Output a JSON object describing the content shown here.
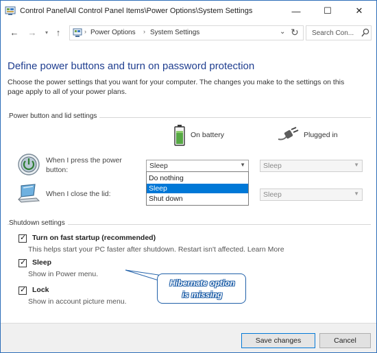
{
  "window": {
    "title": "Control Panel\\All Control Panel Items\\Power Options\\System Settings",
    "minimize": "—",
    "maximize": "☐",
    "close": "✕"
  },
  "nav": {
    "back": "←",
    "forward": "→",
    "history": "▾",
    "up": "↑",
    "breadcrumbs": [
      "Power Options",
      "System Settings"
    ],
    "separator": "›",
    "dropdown": "⌄",
    "refresh": "↻",
    "search_placeholder": "Search Con..."
  },
  "page": {
    "title": "Define power buttons and turn on password protection",
    "description": "Choose the power settings that you want for your computer. The changes you make to the settings on this page apply to all of your power plans."
  },
  "power_section": {
    "label": "Power button and lid settings",
    "columns": {
      "battery": "On battery",
      "plugged": "Plugged in"
    },
    "rows": [
      {
        "label": "When I press the power button:",
        "battery_value": "Sleep",
        "plugged_value": "Sleep"
      },
      {
        "label": "When I close the lid:",
        "battery_value": "",
        "plugged_value": "Sleep"
      }
    ],
    "dropdown_options": [
      "Do nothing",
      "Sleep",
      "Shut down"
    ],
    "dropdown_selected": "Sleep",
    "arrow": "▼"
  },
  "shutdown_section": {
    "label": "Shutdown settings",
    "items": [
      {
        "label": "Turn on fast startup (recommended)",
        "checked": true,
        "description": "This helps start your PC faster after shutdown. Restart isn't affected. Learn More"
      },
      {
        "label": "Sleep",
        "checked": true,
        "description": "Show in Power menu."
      },
      {
        "label": "Lock",
        "checked": true,
        "description": "Show in account picture menu."
      }
    ],
    "check_glyph": "✓"
  },
  "annotation": {
    "line1": "Hibernate option",
    "line2": "is missing"
  },
  "footer": {
    "save": "Save changes",
    "cancel": "Cancel"
  },
  "colors": {
    "title_blue": "#1e3d8f",
    "selection_blue": "#0078d7",
    "annotation_blue": "#1f5fa8"
  }
}
